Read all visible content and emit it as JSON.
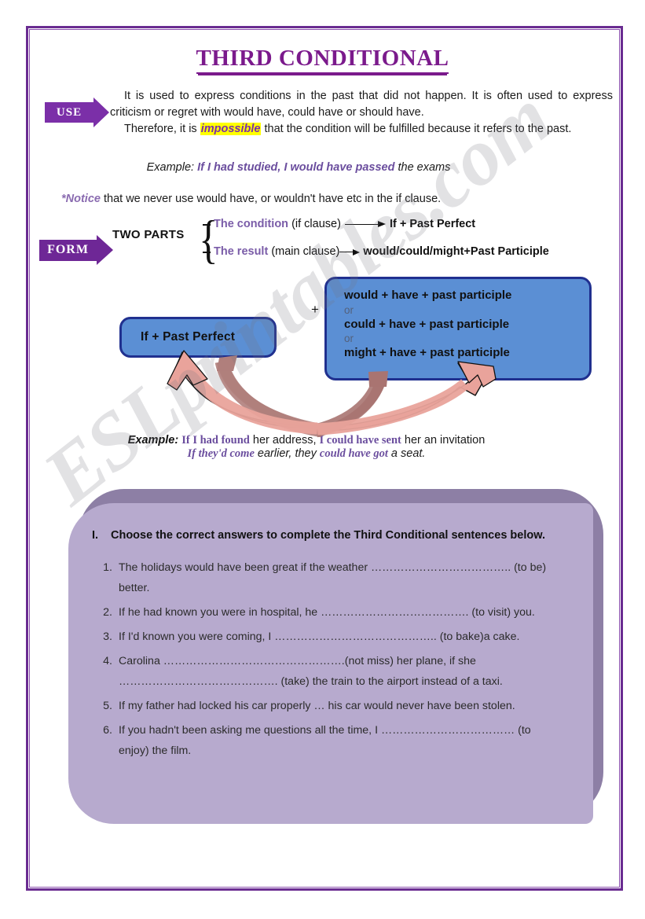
{
  "document": {
    "title": "THIRD CONDITIONAL",
    "watermark": "ESLprintables.com"
  },
  "use_section": {
    "label": "USE",
    "line1": "It is used to express conditions in the past that did not happen. It is often used to express criticism or regret with would have, could have or should have.",
    "line2_before": "Therefore, it is ",
    "line2_highlight": "impossible",
    "line2_after": " that the condition will be fulfilled because it refers to the past."
  },
  "example1": {
    "label": "Example: ",
    "emphasis1": "If I had studied, I would have passed",
    "tail": " the exams"
  },
  "notice": {
    "label": "*Notice",
    "text": "  that we never use would have, or wouldn't have etc in the if clause."
  },
  "form_section": {
    "label": "FORM",
    "two_parts": "TWO PARTS",
    "condition_label": "The condition",
    "condition_clause": " (if clause)",
    "condition_result": "If + Past Perfect",
    "result_label": "The result",
    "result_clause": "  (main clause)",
    "result_formula": "would/could/might+Past Participle"
  },
  "diagram": {
    "if_box": "If + Past Perfect",
    "plus": "+",
    "result_box": {
      "line1": "would + have + past participle",
      "or1": "or",
      "line2": "could + have + past participle",
      "or2": "or",
      "line3": "might + have + past participle"
    }
  },
  "example2": {
    "label": "Example: ",
    "line1_em1": "If I had found",
    "line1_mid": " her address, ",
    "line1_em2": "I could have sent",
    "line1_tail": " her an invitation",
    "line2_em1": "If they'd come",
    "line2_mid": " earlier, they ",
    "line2_em2": "could have got",
    "line2_tail": " a seat."
  },
  "exercise": {
    "number": "I.",
    "heading": "Choose the correct answers to complete the Third Conditional sentences below.",
    "questions": [
      {
        "num": "1.",
        "text": "The holidays would have been great if the weather ……………………………….. (to be) better."
      },
      {
        "num": "2.",
        "text": "If he had known you were in hospital, he …………………………………. (to visit) you."
      },
      {
        "num": "3.",
        "text": "If I'd known you were coming, I …………………………………….. (to bake)a cake."
      },
      {
        "num": "4.",
        "text": "Carolina ………………………………………….(not miss) her plane, if she ……………………………………. (take) the train to the airport instead of a taxi."
      },
      {
        "num": "5.",
        "text": "If my father had locked his car properly … his car would never have been stolen."
      },
      {
        "num": "6.",
        "text": "If you hadn't been asking me questions all the time, I ……………………………… (to enjoy) the film."
      }
    ]
  },
  "colors": {
    "title_purple": "#7b1a8c",
    "arrow_purple": "#7b2fa8",
    "box_blue": "#5b8fd4",
    "box_border": "#20308f",
    "panel_lavender": "#b7aace",
    "panel_shadow": "#8d7fa5",
    "highlight_yellow": "#ffff00",
    "flow_arrow_pink": "#e9a39b"
  }
}
